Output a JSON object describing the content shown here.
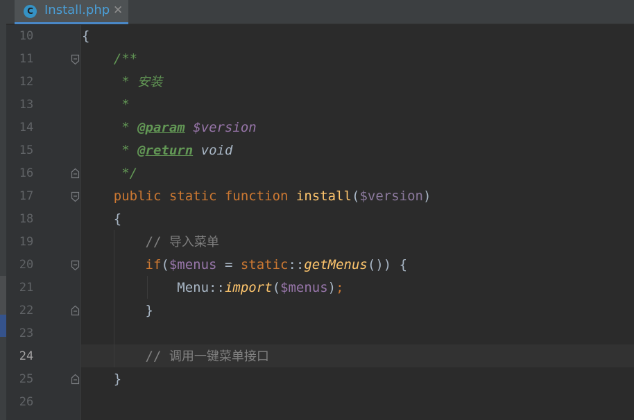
{
  "tab": {
    "icon_letter": "C",
    "file_name": "Install.php",
    "close_glyph": "✕"
  },
  "gutter": {
    "line_numbers": [
      "10",
      "11",
      "12",
      "13",
      "14",
      "15",
      "16",
      "17",
      "18",
      "19",
      "20",
      "21",
      "22",
      "23",
      "24",
      "25",
      "26"
    ],
    "current_line": "24"
  },
  "code": {
    "l10": {
      "brace": "{"
    },
    "l11": {
      "doc_open": "/**"
    },
    "l12": {
      "star": "* ",
      "text": "安装"
    },
    "l13": {
      "star": "*"
    },
    "l14": {
      "star": "* ",
      "tag": "@param",
      "var": "$version"
    },
    "l15": {
      "star": "* ",
      "tag": "@return",
      "type": "void"
    },
    "l16": {
      "doc_close": "*/"
    },
    "l17": {
      "kw_public": "public",
      "kw_static": "static",
      "kw_function": "function",
      "name": "install",
      "open": "(",
      "param": "$version",
      "close": ")"
    },
    "l18": {
      "brace": "{"
    },
    "l19": {
      "slashes": "// ",
      "text": "导入菜单"
    },
    "l20": {
      "kw_if": "if",
      "open": "(",
      "var": "$menus",
      "assign": " = ",
      "kw_static": "static",
      "dcolon": "::",
      "call": "getMenus",
      "rest": "()) {"
    },
    "l21": {
      "cls": "Menu",
      "dcolon": "::",
      "call": "import",
      "open": "(",
      "var": "$menus",
      "close": ")",
      "semi": ";"
    },
    "l22": {
      "brace": "}"
    },
    "l24": {
      "slashes": "// ",
      "text": "调用一键菜单接口"
    },
    "l25": {
      "brace": "}"
    }
  },
  "colors": {
    "keyword": "#cc7832",
    "function": "#ffc66d",
    "variable": "#9876aa",
    "doc_comment": "#629755",
    "line_comment": "#808080",
    "tab_accent": "#4a88c7"
  }
}
